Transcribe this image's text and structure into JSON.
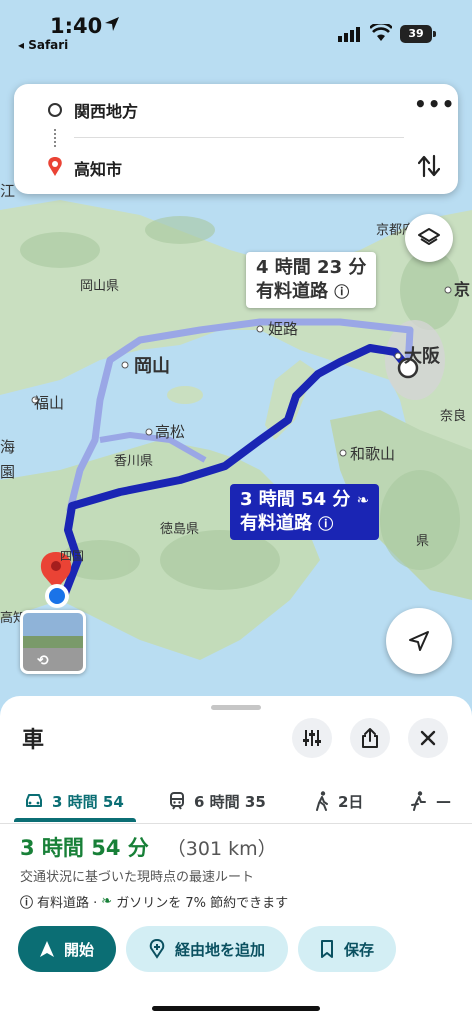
{
  "status_bar": {
    "time": "1:40",
    "back_label": "◂ Safari",
    "battery": "39"
  },
  "route_card": {
    "origin": "関西地方",
    "destination": "高知市",
    "more_label": "•••"
  },
  "map": {
    "labels": {
      "kyoto": "京都府",
      "kyo": "京",
      "okayama_pref": "岡山県",
      "okayama": "岡山",
      "himeji": "姫路",
      "osaka": "大阪",
      "nara": "奈良",
      "fukuyama": "福山",
      "takamatsu": "高松",
      "kagawa": "香川県",
      "wakayama": "和歌山",
      "tokushima": "徳島県",
      "ken": "県",
      "shikoku": "四国",
      "kochi": "高知",
      "e": "江",
      "umi": "海",
      "en": "園"
    },
    "callout_alt": {
      "time": "4 時間 23 分",
      "toll": "有料道路"
    },
    "callout_main": {
      "time": "3 時間 54 分",
      "toll": "有料道路"
    }
  },
  "sheet": {
    "mode_title": "車",
    "tabs": [
      {
        "label": "3 時間 54",
        "icon": "car-icon"
      },
      {
        "label": "6 時間 35",
        "icon": "train-icon"
      },
      {
        "label": "2日",
        "icon": "walk-icon"
      },
      {
        "label": "—",
        "icon": "bike-icon"
      }
    ],
    "summary": {
      "duration": "3 時間 54 分",
      "distance": "（301 km）",
      "description": "交通状況に基づいた現時点の最速ルート",
      "toll_note": "有料道路 ·",
      "fuel_note": "ガソリンを 7% 節約できます"
    },
    "actions": {
      "start": "開始",
      "add_stop": "経由地を追加",
      "save": "保存"
    }
  },
  "colors": {
    "accent": "#0b6e74",
    "route": "#1a25b4",
    "duration_green": "#188038",
    "pin_red": "#ea4335",
    "location_blue": "#1a73e8"
  }
}
